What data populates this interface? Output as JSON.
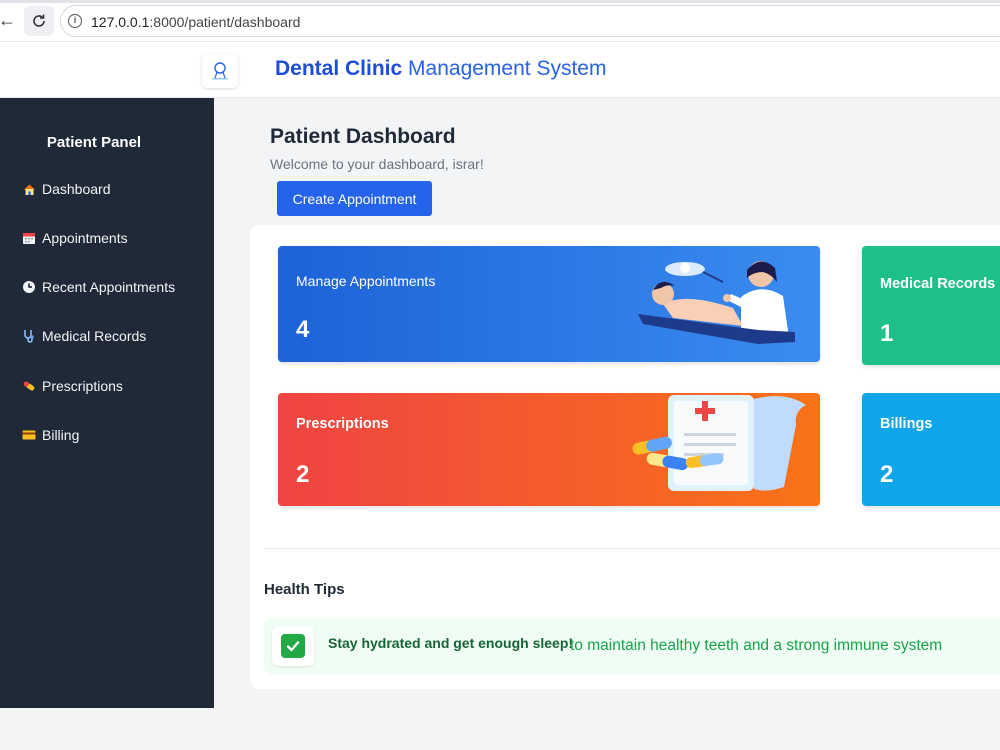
{
  "browser": {
    "url_host": "127.0.0.1",
    "url_rest": ":8000/patient/dashboard"
  },
  "header": {
    "title_strong": "Dental Clinic",
    "title_rest": " Management System"
  },
  "sidebar": {
    "title": "Patient Panel",
    "items": [
      {
        "label": "Dashboard",
        "icon": "home-icon"
      },
      {
        "label": "Appointments",
        "icon": "calendar-icon"
      },
      {
        "label": "Recent Appointments",
        "icon": "clock-icon"
      },
      {
        "label": "Medical Records",
        "icon": "stethoscope-icon"
      },
      {
        "label": "Prescriptions",
        "icon": "pill-icon"
      },
      {
        "label": "Billing",
        "icon": "credit-card-icon"
      }
    ]
  },
  "main": {
    "title": "Patient Dashboard",
    "welcome": "Welcome to your dashboard, israr!",
    "create_button": "Create Appointment",
    "cards": {
      "appointments": {
        "label": "Manage Appointments",
        "count": "4",
        "color": "#2563eb"
      },
      "medical": {
        "label": "Medical Records",
        "count": "1",
        "color": "#1ec08a"
      },
      "prescriptions": {
        "label": "Prescriptions",
        "count": "2",
        "color": "#ef4444"
      },
      "billings": {
        "label": "Billings",
        "count": "2",
        "color": "#0ea5e9"
      }
    },
    "tips": {
      "title": "Health Tips",
      "strong": "Stay hydrated and get enough sleep!",
      "rest": "to maintain healthy teeth and a strong immune system"
    }
  }
}
